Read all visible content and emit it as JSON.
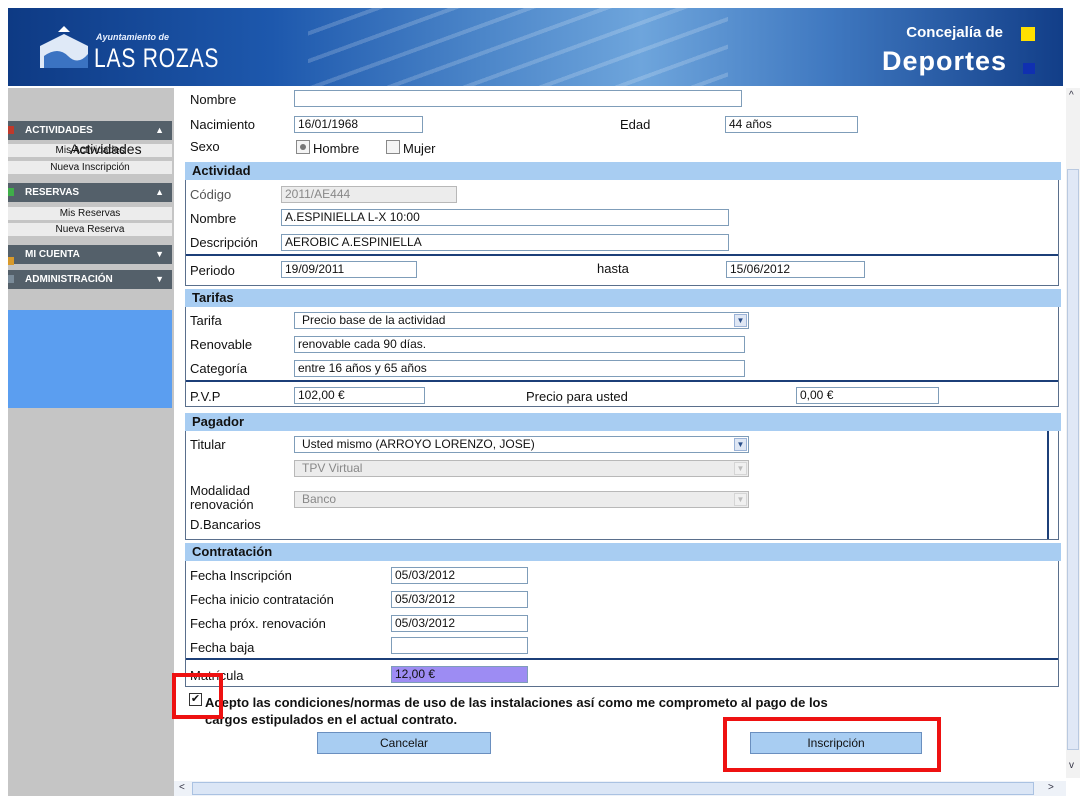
{
  "header": {
    "logo_small": "Ayuntamiento de",
    "logo_text": "LAS ROZAS",
    "subtitle": "Concejalía de",
    "title": "Deportes",
    "colors": {
      "yellow": "#ffe000",
      "blue": "#1030b0"
    }
  },
  "sidebar": {
    "sections": [
      {
        "label": "ACTIVIDADES",
        "arrow": "▲",
        "items": [
          "Mis Actividades",
          "Nueva Inscripción"
        ]
      },
      {
        "label": "RESERVAS",
        "arrow": "▲",
        "items": [
          "Mis Reservas",
          "Nueva Reserva"
        ]
      },
      {
        "label": "MI CUENTA",
        "arrow": "▼",
        "items": []
      },
      {
        "label": "ADMINISTRACIÓN",
        "arrow": "▼",
        "items": []
      }
    ],
    "overlay_label": "Actividades"
  },
  "personal": {
    "nombre_label": "Nombre",
    "nombre_value": "",
    "nacimiento_label": "Nacimiento",
    "nacimiento_value": "16/01/1968",
    "edad_label": "Edad",
    "edad_value": "44 años",
    "sexo_label": "Sexo",
    "hombre_label": "Hombre",
    "mujer_label": "Mujer",
    "selected": "Hombre"
  },
  "actividad": {
    "heading": "Actividad",
    "codigo_label": "Código",
    "codigo_value": "2011/AE444",
    "nombre_label": "Nombre",
    "nombre_value": "A.ESPINIELLA L-X 10:00",
    "descripcion_label": "Descripción",
    "descripcion_value": "AEROBIC A.ESPINIELLA",
    "periodo_label": "Periodo",
    "periodo_value": "19/09/2011",
    "hasta_label": "hasta",
    "hasta_value": "15/06/2012"
  },
  "tarifas": {
    "heading": "Tarifas",
    "tarifa_label": "Tarifa",
    "tarifa_value": "Precio base de la actividad",
    "renovable_label": "Renovable",
    "renovable_value": "renovable cada 90 días.",
    "categoria_label": "Categoría",
    "categoria_value": "entre 16 años y 65 años",
    "pvp_label": "P.V.P",
    "pvp_value": "102,00 €",
    "precio_usted_label": "Precio para usted",
    "precio_usted_value": "0,00 €"
  },
  "pagador": {
    "heading": "Pagador",
    "titular_label": "Titular",
    "titular_value": "Usted mismo (ARROYO LORENZO, JOSE)",
    "pago_value": "TPV Virtual",
    "modalidad_label_1": "Modalidad",
    "modalidad_label_2": "renovación",
    "modalidad_value": "Banco",
    "bancarios_label": "D.Bancarios"
  },
  "contratacion": {
    "heading": "Contratación",
    "inscripcion_label": "Fecha Inscripción",
    "inscripcion_value": "05/03/2012",
    "inicio_label": "Fecha inicio contratación",
    "inicio_value": "05/03/2012",
    "renovacion_label": "Fecha próx. renovación",
    "renovacion_value": "05/03/2012",
    "baja_label": "Fecha baja",
    "baja_value": "",
    "matricula_label": "Matrícula",
    "matricula_value": "12,00 €"
  },
  "accept": {
    "checked": true,
    "line1": "Acepto las condiciones/normas de uso de las instalaciones así como me comprometo al pago de los",
    "line2": "cargos estipulados en el actual contrato."
  },
  "buttons": {
    "cancelar": "Cancelar",
    "inscripcion": "Inscripción"
  },
  "scroll": {
    "up": "^",
    "down": "v",
    "left": "<",
    "right": ">"
  }
}
